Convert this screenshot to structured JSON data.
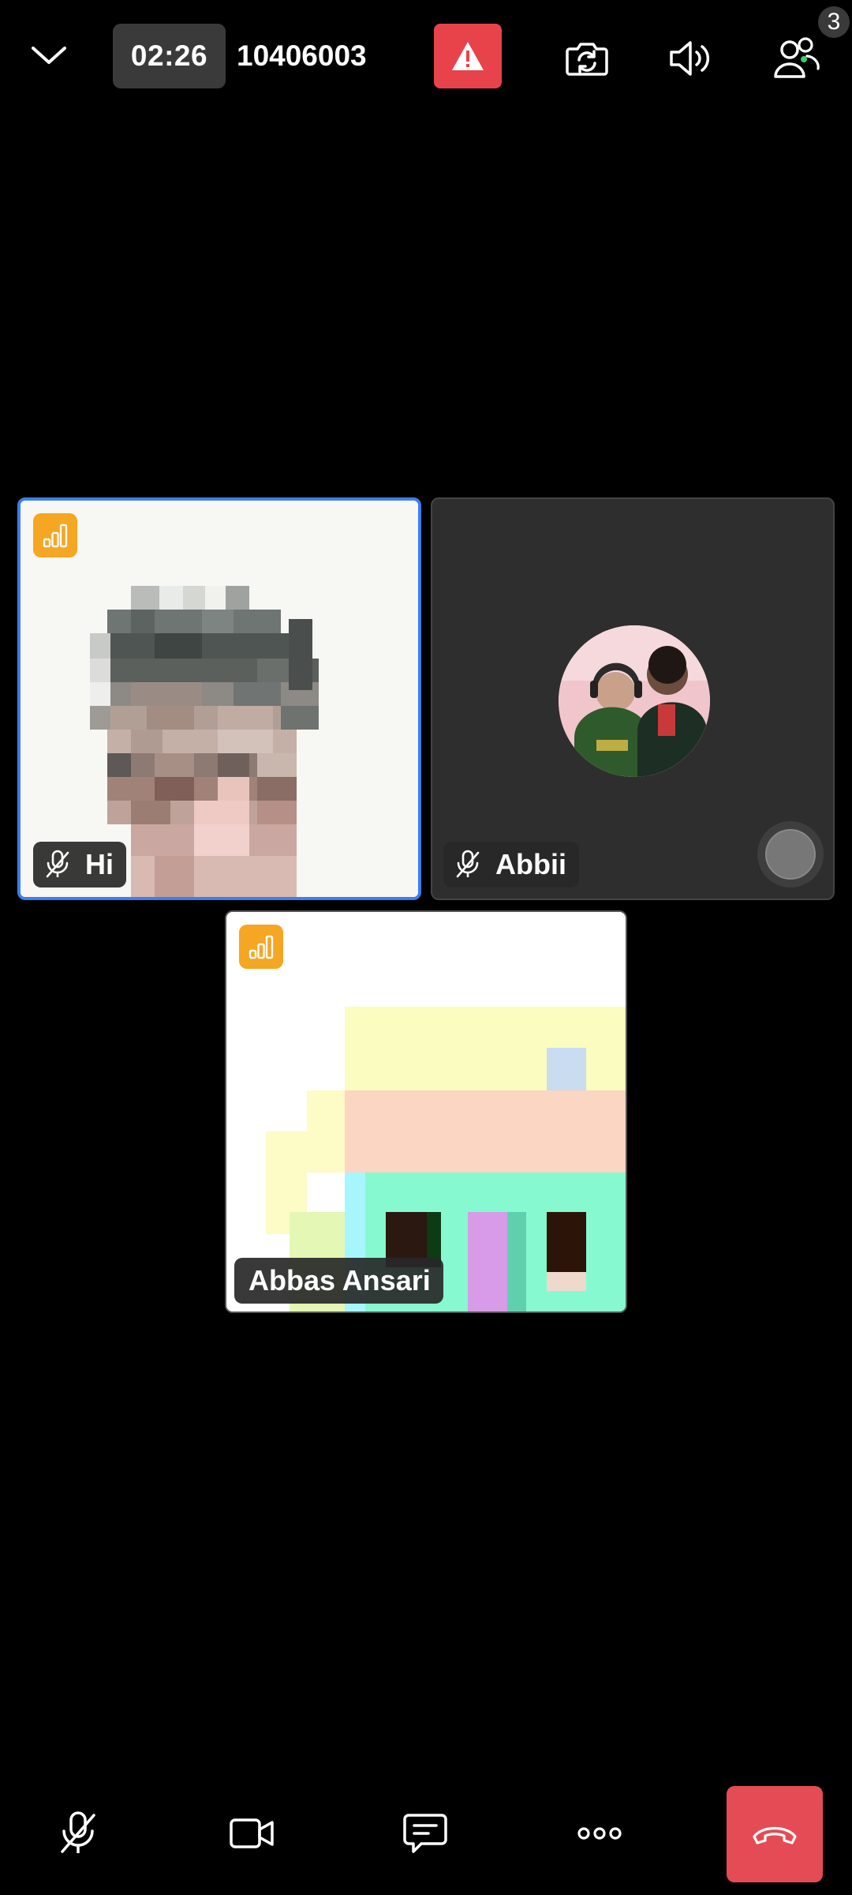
{
  "header": {
    "timer": "02:26",
    "meeting_id": "10406003",
    "participants_count": "3"
  },
  "tiles": {
    "hi": {
      "name": "Hi",
      "muted": true
    },
    "abbii": {
      "name": "Abbii",
      "muted": true
    },
    "abbas": {
      "name": "Abbas Ansari",
      "muted": false
    }
  },
  "icons": {
    "collapse": "chevron-down-icon",
    "alert": "warning-icon",
    "camera_switch": "camera-switch-icon",
    "speaker": "speaker-icon",
    "participants": "participants-icon",
    "signal": "signal-bars-icon",
    "mic_off": "mic-off-icon",
    "video": "video-camera-icon",
    "chat": "chat-icon",
    "more": "more-dots-icon",
    "end_call": "end-call-icon"
  },
  "colors": {
    "background": "#000000",
    "active_speaker_border": "#3d7ef0",
    "alert": "#e8434b",
    "signal_badge": "#f5a623",
    "end_call": "#e54b55",
    "timer_bg": "#3a3a3a"
  }
}
